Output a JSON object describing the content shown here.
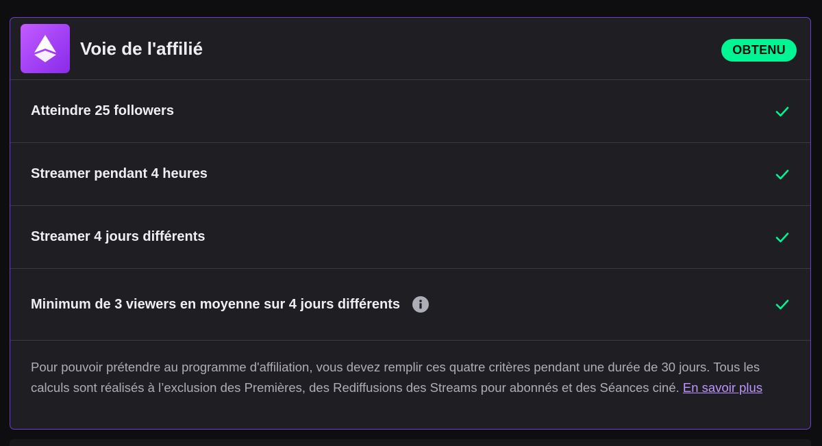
{
  "header": {
    "title": "Voie de l'affilié",
    "badge": "OBTENU",
    "icon": "affiliate-path-icon"
  },
  "criteria": [
    {
      "label": "Atteindre 25 followers",
      "status": "completed",
      "icon": "check-icon"
    },
    {
      "label": "Streamer pendant 4 heures",
      "status": "completed",
      "icon": "check-icon"
    },
    {
      "label": "Streamer 4 jours différents",
      "status": "completed",
      "icon": "check-icon"
    },
    {
      "label": "Minimum de 3 viewers en moyenne sur 4 jours différents",
      "status": "completed",
      "icon": "check-icon",
      "has_info": true
    }
  ],
  "footer": {
    "text": "Pour pouvoir prétendre au programme d'affiliation, vous devez remplir ces quatre critères pendant une durée de 30 jours. Tous les calculs sont réalisés à l’exclusion des Premières, des Rediffusions des Streams pour abonnés et des Séances ciné.",
    "link_label": "En savoir plus"
  },
  "colors": {
    "accent_border": "#6d3fd1",
    "badge_bg": "#00f593",
    "check": "#00f593",
    "link": "#bf94ff",
    "card_bg": "#1f1f23"
  }
}
